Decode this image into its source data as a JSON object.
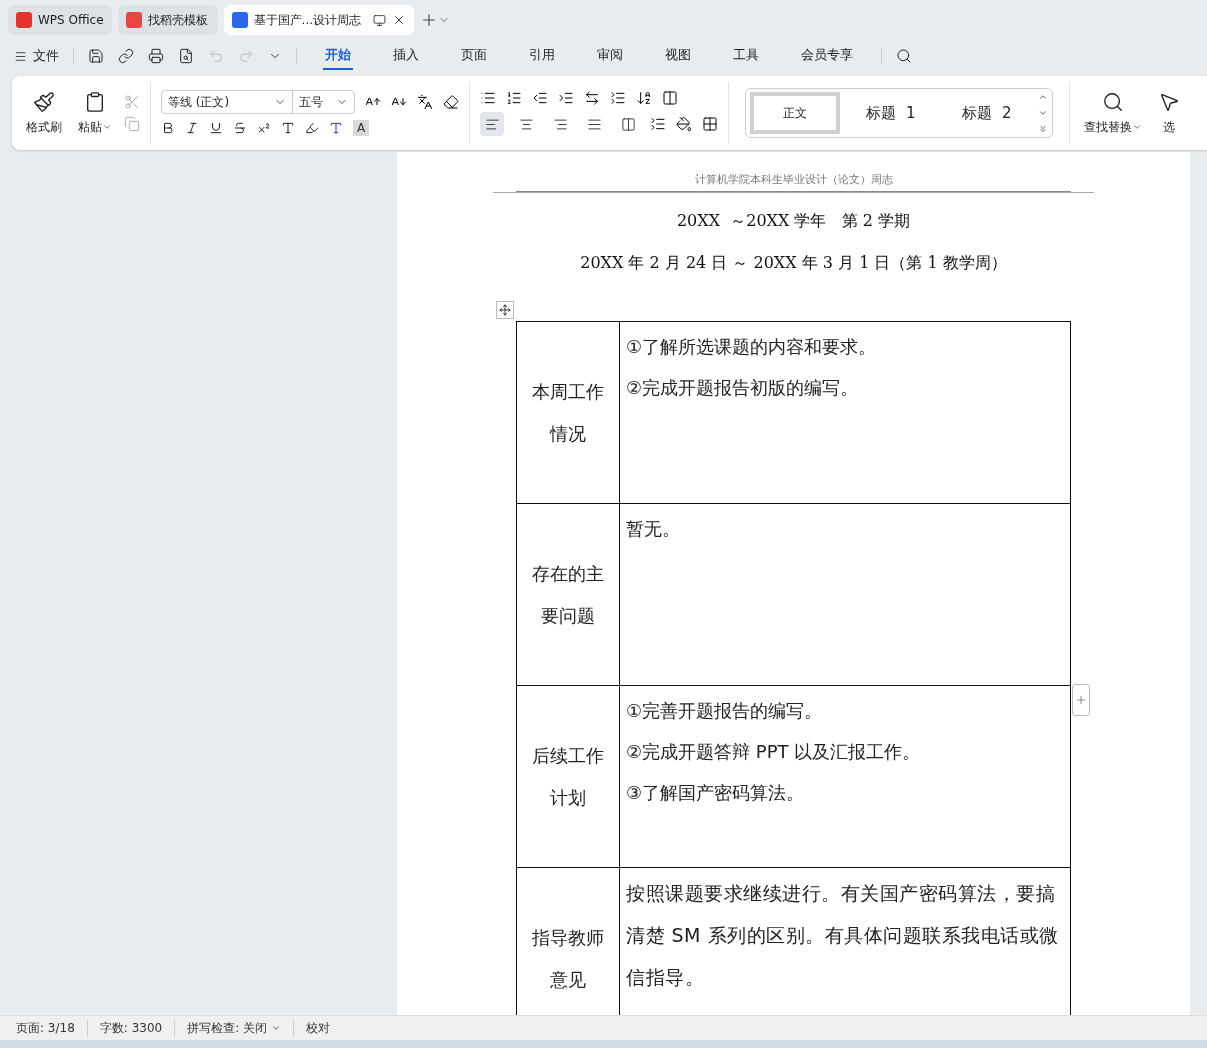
{
  "tabs": [
    {
      "label": "WPS Office",
      "kind": "wps",
      "selected": false
    },
    {
      "label": "找稻壳模板",
      "kind": "template",
      "selected": false
    },
    {
      "label": "基于国产...设计周志",
      "kind": "doc",
      "selected": true
    }
  ],
  "menu": {
    "file": "文件",
    "items": [
      {
        "label": "开始",
        "selected": true
      },
      {
        "label": "插入",
        "selected": false
      },
      {
        "label": "页面",
        "selected": false
      },
      {
        "label": "引用",
        "selected": false
      },
      {
        "label": "审阅",
        "selected": false
      },
      {
        "label": "视图",
        "selected": false
      },
      {
        "label": "工具",
        "selected": false
      },
      {
        "label": "会员专享",
        "selected": false
      }
    ]
  },
  "ribbon": {
    "format_painter": "格式刷",
    "paste": "粘贴",
    "font": "等线 (正文)",
    "size": "五号",
    "shading_letter": "A",
    "align_buttons": [
      {
        "selected": true
      },
      {
        "selected": false
      },
      {
        "selected": false
      },
      {
        "selected": false
      },
      {
        "selected": false
      }
    ],
    "styles": [
      {
        "label": "正文",
        "selected": true
      },
      {
        "label": "标题  1",
        "selected": false
      },
      {
        "label": "标题  2",
        "selected": false
      }
    ],
    "find": "查找替换",
    "select": "选"
  },
  "document": {
    "header": "计算机学院本科生毕业设计（论文）周志",
    "lines": [
      "20XX  ～20XX 学年   第 2 学期",
      "20XX 年 2 月 24 日 ～ 20XX 年 3 月 1 日（第 1 教学周）"
    ],
    "rows": [
      {
        "heading": [
          "本周工作",
          "情况"
        ],
        "kind": "list",
        "items": [
          "①了解所选课题的内容和要求。",
          "②完成开题报告初版的编写。"
        ]
      },
      {
        "heading": [
          "存在的主",
          "要问题"
        ],
        "kind": "list",
        "items": [
          "暂无。"
        ]
      },
      {
        "heading": [
          "后续工作",
          "计划"
        ],
        "kind": "list",
        "items": [
          "①完善开题报告的编写。",
          "②完成开题答辩 PPT 以及汇报工作。",
          "③了解国产密码算法。"
        ]
      },
      {
        "heading": [
          "指导教师",
          "意见"
        ],
        "kind": "paragraph",
        "items": [
          "按照课题要求继续进行。有关国产密码算法，要搞清楚 SM 系列的区别。有具体问题联系我电话或微信指导。"
        ]
      }
    ]
  },
  "status_bar": [
    {
      "label": "页面: 3/18",
      "dropdown": false
    },
    {
      "label": "字数: 3300",
      "dropdown": false
    },
    {
      "label": "拼写检查: 关闭",
      "dropdown": true
    },
    {
      "label": "校对",
      "dropdown": false
    }
  ]
}
